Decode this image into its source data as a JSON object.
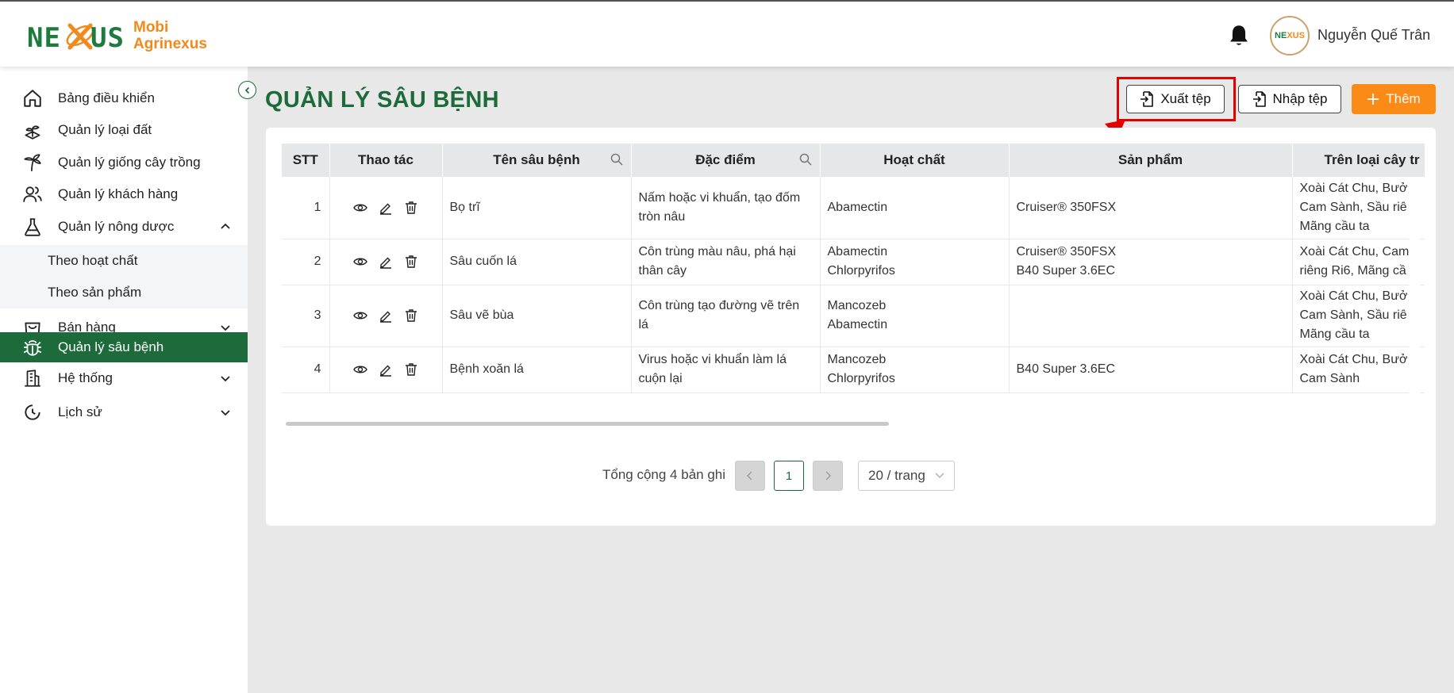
{
  "brand": {
    "logo_left": "NE",
    "logo_right": "US",
    "line1": "Mobi",
    "line2": "Agrinexus"
  },
  "user": {
    "name": "Nguyễn Quế Trân",
    "avatar_text_a": "NE",
    "avatar_text_b": "XUS"
  },
  "sidebar": {
    "items": [
      {
        "label": "Bảng điều khiển",
        "icon": "home-icon"
      },
      {
        "label": "Quản lý loại đất",
        "icon": "soil-icon"
      },
      {
        "label": "Quản lý giống cây trồng",
        "icon": "plant-icon"
      },
      {
        "label": "Quản lý khách hàng",
        "icon": "users-icon"
      },
      {
        "label": "Quản lý nông dược",
        "icon": "flask-icon"
      },
      {
        "label": "Bán hàng",
        "icon": "bag-icon"
      },
      {
        "label": "Quản lý sâu bệnh",
        "icon": "bug-icon"
      },
      {
        "label": "Hệ thống",
        "icon": "building-icon"
      },
      {
        "label": "Lịch sử",
        "icon": "clock-icon"
      }
    ],
    "sub_items": [
      "Theo hoạt chất",
      "Theo sản phẩm"
    ]
  },
  "page": {
    "title": "QUẢN LÝ SÂU BỆNH",
    "export_label": "Xuất tệp",
    "import_label": "Nhập tệp",
    "add_label": "Thêm"
  },
  "table": {
    "headers": [
      "STT",
      "Thao tác",
      "Tên sâu bệnh",
      "Đặc điểm",
      "Hoạt chất",
      "Sản phẩm",
      "Trên loại cây tr"
    ],
    "rows": [
      {
        "stt": "1",
        "name": "Bọ trĩ",
        "feature": [
          "Nấm hoặc vi khuẩn, tạo đốm",
          "tròn nâu"
        ],
        "ingredient": [
          "Abamectin"
        ],
        "product": [
          "Cruiser® 350FSX"
        ],
        "crops": [
          "Xoài Cát Chu, Bưở",
          "Cam Sành, Sầu riê",
          "Mãng cầu ta"
        ]
      },
      {
        "stt": "2",
        "name": "Sâu cuốn lá",
        "feature": [
          "Côn trùng màu nâu, phá hại",
          "thân cây"
        ],
        "ingredient": [
          "Abamectin",
          "Chlorpyrifos"
        ],
        "product": [
          "Cruiser® 350FSX",
          "B40 Super 3.6EC"
        ],
        "crops": [
          "Xoài Cát Chu, Cam",
          "riêng Ri6, Mãng cầ"
        ]
      },
      {
        "stt": "3",
        "name": "Sâu vẽ bùa",
        "feature": [
          "Côn trùng tạo đường vẽ trên",
          "lá"
        ],
        "ingredient": [
          "Mancozeb",
          "Abamectin"
        ],
        "product": [],
        "crops": [
          "Xoài Cát Chu, Bưở",
          "Cam Sành, Sầu riê",
          "Mãng cầu ta"
        ]
      },
      {
        "stt": "4",
        "name": "Bệnh xoăn lá",
        "feature": [
          "Virus hoặc vi khuẩn làm lá",
          "cuộn lại"
        ],
        "ingredient": [
          "Mancozeb",
          "Chlorpyrifos"
        ],
        "product": [
          "B40 Super 3.6EC"
        ],
        "crops": [
          "Xoài Cát Chu, Bưở",
          "Cam Sành"
        ]
      }
    ]
  },
  "pagination": {
    "total": "Tổng cộng 4 bản ghi",
    "current_page": "1",
    "page_size": "20 / trang"
  },
  "colors": {
    "primary_green": "#1d6a3a",
    "accent_orange": "#fb8b17",
    "highlight_red": "#e30000"
  }
}
